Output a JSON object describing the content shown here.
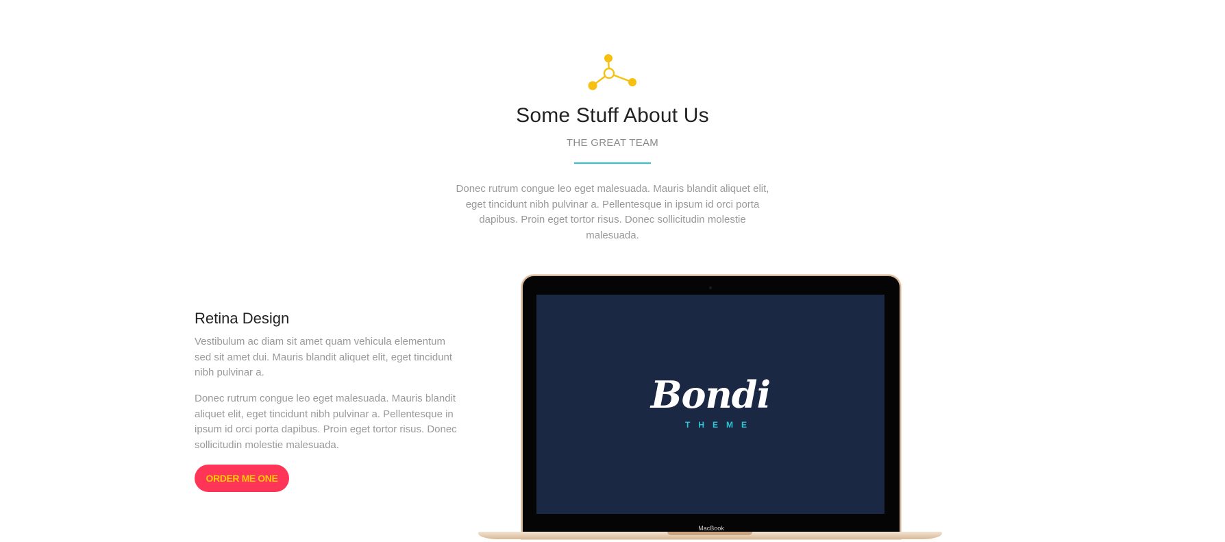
{
  "section": {
    "icon": "network-nodes-icon",
    "title": "Some Stuff About Us",
    "subtitle": "THE GREAT TEAM",
    "intro": "Donec rutrum congue leo eget malesuada. Mauris blandit aliquet elit, eget tincidunt nibh pulvinar a. Pellentesque in ipsum id orci porta dapibus. Proin eget tortor risus. Donec sollicitudin molestie malesuada."
  },
  "feature": {
    "title": "Retina Design",
    "paragraph1": "Vestibulum ac diam sit amet quam vehicula elementum sed sit amet dui. Mauris blandit aliquet elit, eget tincidunt nibh pulvinar a.",
    "paragraph2": "Donec rutrum congue leo eget malesuada. Mauris blandit aliquet elit, eget tincidunt nibh pulvinar a. Pellentesque in ipsum id orci porta dapibus. Proin eget tortor risus. Donec sollicitudin molestie malesuada.",
    "button_label": "ORDER ME ONE"
  },
  "laptop": {
    "brand": "MacBook",
    "screen_logo": "Bondi",
    "screen_logo_sub": "THEME"
  },
  "colors": {
    "accent_yellow": "#f5c00f",
    "accent_teal": "#29c7d4",
    "button_bg": "#ff3558",
    "button_text": "#ffcb05",
    "screen_bg": "#1b2843"
  }
}
